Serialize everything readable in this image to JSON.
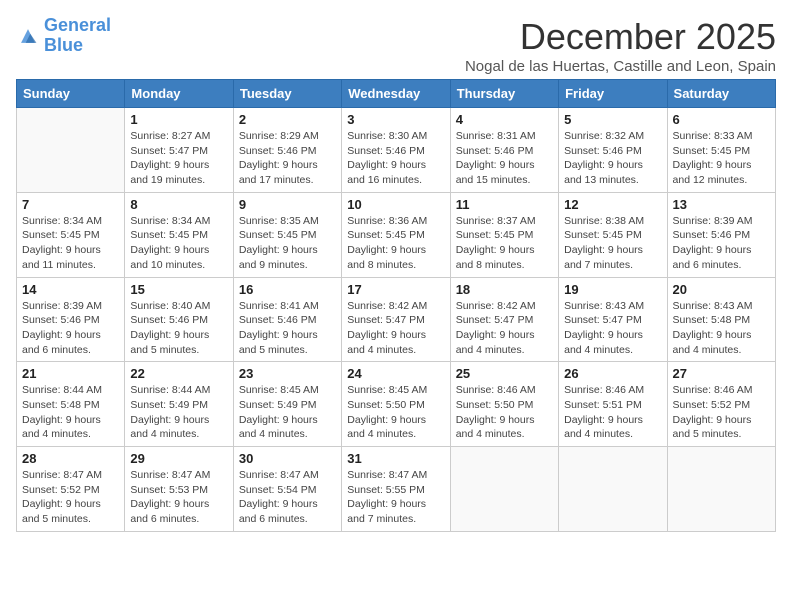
{
  "header": {
    "logo_line1": "General",
    "logo_line2": "Blue",
    "month": "December 2025",
    "location": "Nogal de las Huertas, Castille and Leon, Spain"
  },
  "weekdays": [
    "Sunday",
    "Monday",
    "Tuesday",
    "Wednesday",
    "Thursday",
    "Friday",
    "Saturday"
  ],
  "weeks": [
    [
      {
        "day": "",
        "sunrise": "",
        "sunset": "",
        "daylight": ""
      },
      {
        "day": "1",
        "sunrise": "Sunrise: 8:27 AM",
        "sunset": "Sunset: 5:47 PM",
        "daylight": "Daylight: 9 hours and 19 minutes."
      },
      {
        "day": "2",
        "sunrise": "Sunrise: 8:29 AM",
        "sunset": "Sunset: 5:46 PM",
        "daylight": "Daylight: 9 hours and 17 minutes."
      },
      {
        "day": "3",
        "sunrise": "Sunrise: 8:30 AM",
        "sunset": "Sunset: 5:46 PM",
        "daylight": "Daylight: 9 hours and 16 minutes."
      },
      {
        "day": "4",
        "sunrise": "Sunrise: 8:31 AM",
        "sunset": "Sunset: 5:46 PM",
        "daylight": "Daylight: 9 hours and 15 minutes."
      },
      {
        "day": "5",
        "sunrise": "Sunrise: 8:32 AM",
        "sunset": "Sunset: 5:46 PM",
        "daylight": "Daylight: 9 hours and 13 minutes."
      },
      {
        "day": "6",
        "sunrise": "Sunrise: 8:33 AM",
        "sunset": "Sunset: 5:45 PM",
        "daylight": "Daylight: 9 hours and 12 minutes."
      }
    ],
    [
      {
        "day": "7",
        "sunrise": "Sunrise: 8:34 AM",
        "sunset": "Sunset: 5:45 PM",
        "daylight": "Daylight: 9 hours and 11 minutes."
      },
      {
        "day": "8",
        "sunrise": "Sunrise: 8:34 AM",
        "sunset": "Sunset: 5:45 PM",
        "daylight": "Daylight: 9 hours and 10 minutes."
      },
      {
        "day": "9",
        "sunrise": "Sunrise: 8:35 AM",
        "sunset": "Sunset: 5:45 PM",
        "daylight": "Daylight: 9 hours and 9 minutes."
      },
      {
        "day": "10",
        "sunrise": "Sunrise: 8:36 AM",
        "sunset": "Sunset: 5:45 PM",
        "daylight": "Daylight: 9 hours and 8 minutes."
      },
      {
        "day": "11",
        "sunrise": "Sunrise: 8:37 AM",
        "sunset": "Sunset: 5:45 PM",
        "daylight": "Daylight: 9 hours and 8 minutes."
      },
      {
        "day": "12",
        "sunrise": "Sunrise: 8:38 AM",
        "sunset": "Sunset: 5:45 PM",
        "daylight": "Daylight: 9 hours and 7 minutes."
      },
      {
        "day": "13",
        "sunrise": "Sunrise: 8:39 AM",
        "sunset": "Sunset: 5:46 PM",
        "daylight": "Daylight: 9 hours and 6 minutes."
      }
    ],
    [
      {
        "day": "14",
        "sunrise": "Sunrise: 8:39 AM",
        "sunset": "Sunset: 5:46 PM",
        "daylight": "Daylight: 9 hours and 6 minutes."
      },
      {
        "day": "15",
        "sunrise": "Sunrise: 8:40 AM",
        "sunset": "Sunset: 5:46 PM",
        "daylight": "Daylight: 9 hours and 5 minutes."
      },
      {
        "day": "16",
        "sunrise": "Sunrise: 8:41 AM",
        "sunset": "Sunset: 5:46 PM",
        "daylight": "Daylight: 9 hours and 5 minutes."
      },
      {
        "day": "17",
        "sunrise": "Sunrise: 8:42 AM",
        "sunset": "Sunset: 5:47 PM",
        "daylight": "Daylight: 9 hours and 4 minutes."
      },
      {
        "day": "18",
        "sunrise": "Sunrise: 8:42 AM",
        "sunset": "Sunset: 5:47 PM",
        "daylight": "Daylight: 9 hours and 4 minutes."
      },
      {
        "day": "19",
        "sunrise": "Sunrise: 8:43 AM",
        "sunset": "Sunset: 5:47 PM",
        "daylight": "Daylight: 9 hours and 4 minutes."
      },
      {
        "day": "20",
        "sunrise": "Sunrise: 8:43 AM",
        "sunset": "Sunset: 5:48 PM",
        "daylight": "Daylight: 9 hours and 4 minutes."
      }
    ],
    [
      {
        "day": "21",
        "sunrise": "Sunrise: 8:44 AM",
        "sunset": "Sunset: 5:48 PM",
        "daylight": "Daylight: 9 hours and 4 minutes."
      },
      {
        "day": "22",
        "sunrise": "Sunrise: 8:44 AM",
        "sunset": "Sunset: 5:49 PM",
        "daylight": "Daylight: 9 hours and 4 minutes."
      },
      {
        "day": "23",
        "sunrise": "Sunrise: 8:45 AM",
        "sunset": "Sunset: 5:49 PM",
        "daylight": "Daylight: 9 hours and 4 minutes."
      },
      {
        "day": "24",
        "sunrise": "Sunrise: 8:45 AM",
        "sunset": "Sunset: 5:50 PM",
        "daylight": "Daylight: 9 hours and 4 minutes."
      },
      {
        "day": "25",
        "sunrise": "Sunrise: 8:46 AM",
        "sunset": "Sunset: 5:50 PM",
        "daylight": "Daylight: 9 hours and 4 minutes."
      },
      {
        "day": "26",
        "sunrise": "Sunrise: 8:46 AM",
        "sunset": "Sunset: 5:51 PM",
        "daylight": "Daylight: 9 hours and 4 minutes."
      },
      {
        "day": "27",
        "sunrise": "Sunrise: 8:46 AM",
        "sunset": "Sunset: 5:52 PM",
        "daylight": "Daylight: 9 hours and 5 minutes."
      }
    ],
    [
      {
        "day": "28",
        "sunrise": "Sunrise: 8:47 AM",
        "sunset": "Sunset: 5:52 PM",
        "daylight": "Daylight: 9 hours and 5 minutes."
      },
      {
        "day": "29",
        "sunrise": "Sunrise: 8:47 AM",
        "sunset": "Sunset: 5:53 PM",
        "daylight": "Daylight: 9 hours and 6 minutes."
      },
      {
        "day": "30",
        "sunrise": "Sunrise: 8:47 AM",
        "sunset": "Sunset: 5:54 PM",
        "daylight": "Daylight: 9 hours and 6 minutes."
      },
      {
        "day": "31",
        "sunrise": "Sunrise: 8:47 AM",
        "sunset": "Sunset: 5:55 PM",
        "daylight": "Daylight: 9 hours and 7 minutes."
      },
      {
        "day": "",
        "sunrise": "",
        "sunset": "",
        "daylight": ""
      },
      {
        "day": "",
        "sunrise": "",
        "sunset": "",
        "daylight": ""
      },
      {
        "day": "",
        "sunrise": "",
        "sunset": "",
        "daylight": ""
      }
    ]
  ]
}
